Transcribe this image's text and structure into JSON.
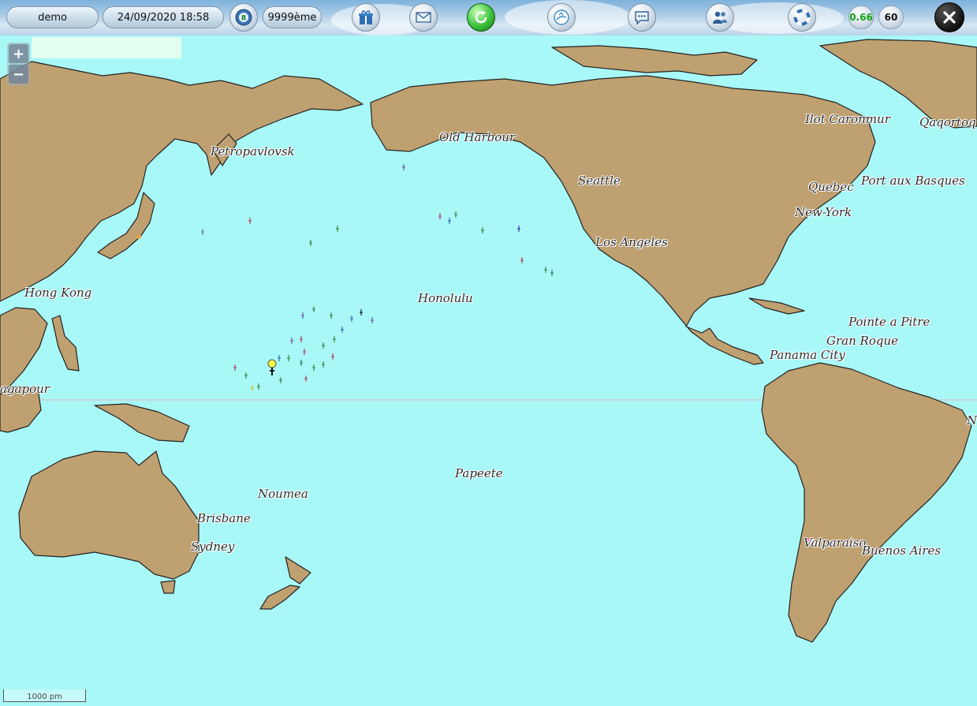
{
  "toolbar": {
    "user": "demo",
    "datetime": "24/09/2020 18:58",
    "wind_badge": "8",
    "rank": "9999ème",
    "speed": "0.66",
    "heading": "60"
  },
  "map": {
    "zoom_in": "+",
    "zoom_out": "−",
    "scale_label": "1000 pm",
    "cities": [
      "Petropavlovsk",
      "Old Harbour",
      "Seattle",
      "Ilot Caronmur",
      "Qaqortoq",
      "Quebec",
      "Port aux Basques",
      "New-York",
      "Los Angeles",
      "Hong Kong",
      "Honolulu",
      "Pointe a Pitre",
      "Gran Roque",
      "Panama City",
      "agapour",
      "Papeete",
      "Noumea",
      "Brisbane",
      "Sydney",
      "Valparaiso",
      "Buenos Aires",
      "N"
    ]
  },
  "colors": {
    "ocean": "#a9f8f8",
    "land": "#bfa070",
    "coast": "#222222",
    "equator": "#e8b0b0"
  }
}
